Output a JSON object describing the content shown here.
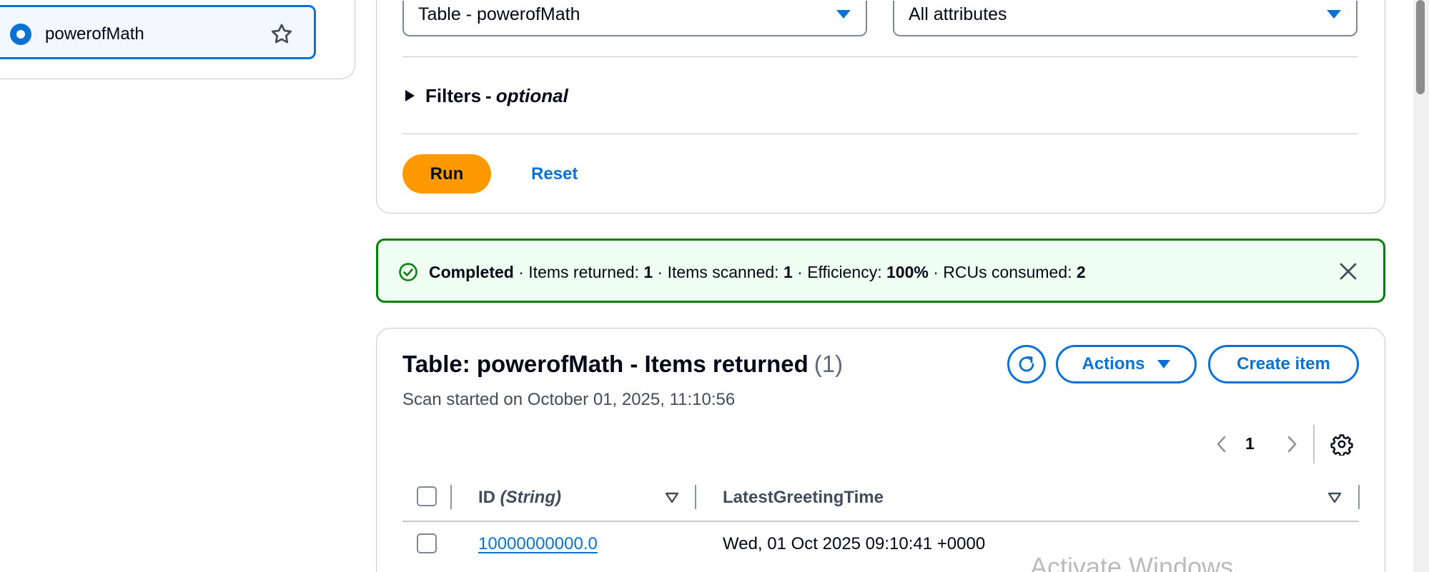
{
  "sidebar": {
    "selected_table": "powerofMath"
  },
  "query_form": {
    "table_select_value": "Table - powerofMath",
    "projection_select_value": "All attributes",
    "filters_title": "Filters",
    "filters_separator": "-",
    "filters_optional": "optional",
    "run_label": "Run",
    "reset_label": "Reset"
  },
  "status_banner": {
    "status": "Completed",
    "items_returned_label": "· Items returned:",
    "items_returned": "1",
    "items_scanned_label": "· Items scanned:",
    "items_scanned": "1",
    "efficiency_label": "· Efficiency:",
    "efficiency": "100%",
    "rcus_label": "· RCUs consumed:",
    "rcus": "2"
  },
  "results": {
    "title": "Table: powerofMath - Items returned",
    "count": "(1)",
    "subtitle": "Scan started on October 01, 2025, 11:10:56",
    "actions_label": "Actions",
    "create_label": "Create item",
    "current_page": "1",
    "columns": {
      "id_name": "ID",
      "id_type": "(String)",
      "latest": "LatestGreetingTime"
    },
    "rows": [
      {
        "id": "10000000000.0",
        "latest": "Wed, 01 Oct 2025 09:10:41 +0000"
      }
    ]
  },
  "watermark": "Activate Windows",
  "colors": {
    "link_blue": "#0972d3",
    "run_orange": "#ff9900",
    "success_green": "#037f0c",
    "success_bg": "#effff1"
  },
  "icons": [
    "radio-selected-icon",
    "star-icon",
    "caret-down-icon",
    "caret-right-icon",
    "check-circle-icon",
    "close-icon",
    "refresh-icon",
    "chevron-left-icon",
    "chevron-right-icon",
    "settings-icon",
    "sort-icon"
  ]
}
